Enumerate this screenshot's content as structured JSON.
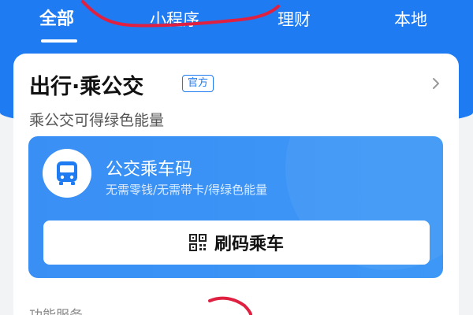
{
  "tabs": [
    {
      "label": "全部",
      "active": true
    },
    {
      "label": "小程序",
      "active": false
    },
    {
      "label": "理财",
      "active": false
    },
    {
      "label": "本地",
      "active": false
    }
  ],
  "card": {
    "title": "出行·乘公交",
    "badge": "官方",
    "subtitle": "乘公交可得绿色能量",
    "chevron_icon": "chevron-right-icon"
  },
  "bus_panel": {
    "icon": "bus-icon",
    "title": "公交乘车码",
    "subtitle": "无需零钱/无需带卡/得绿色能量",
    "button_label": "刷码乘车",
    "button_icon": "qr-code-icon"
  },
  "section": {
    "label": "功能服务"
  },
  "colors": {
    "brand_blue": "#1f7bf2",
    "panel_blue": "#3a8ff5",
    "scribble_red": "#e02040"
  }
}
